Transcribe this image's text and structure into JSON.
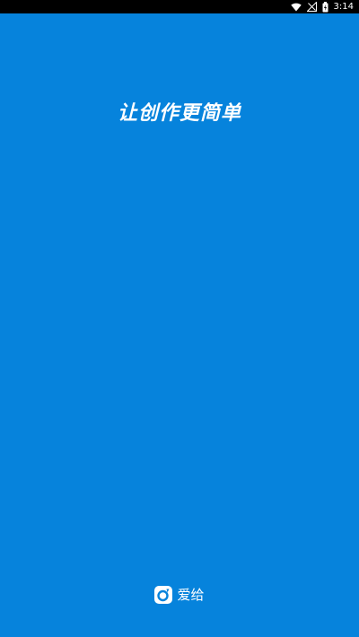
{
  "status_bar": {
    "time": "3:14",
    "icons": [
      "wifi-icon",
      "no-signal-icon",
      "battery-charging-icon"
    ]
  },
  "splash": {
    "slogan": "让创作更简单",
    "brand_name": "爱给",
    "brand_logo_icon": "aigei-logo-icon"
  },
  "colors": {
    "background": "#0683dc",
    "status_bar": "#000000",
    "text": "#ffffff"
  }
}
